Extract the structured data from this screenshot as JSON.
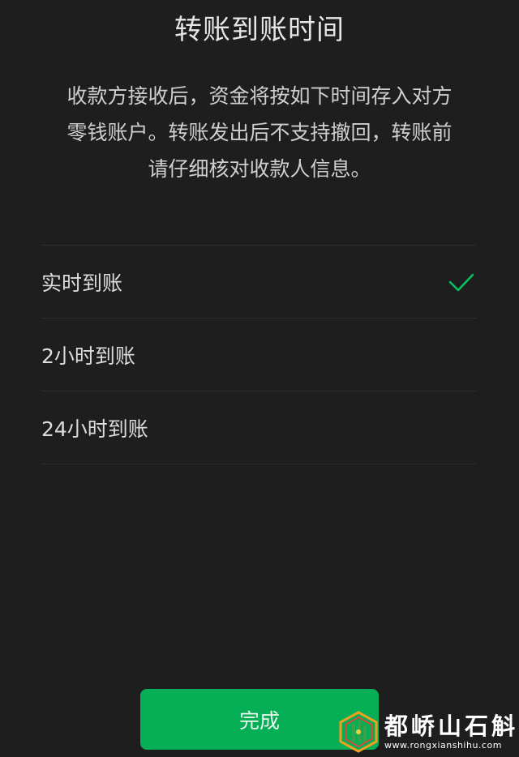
{
  "title": "转账到账时间",
  "description": {
    "line1": "收款方接收后，资金将按如下时间存入对方",
    "line2": "零钱账户。转账发出后不支持撤回，转账前",
    "line3": "请仔细核对收款人信息。"
  },
  "options": [
    {
      "label": "实时到账",
      "selected": true
    },
    {
      "label": "2小时到账",
      "selected": false
    },
    {
      "label": "24小时到账",
      "selected": false
    }
  ],
  "done_button": {
    "label": "完成"
  },
  "watermark": {
    "text": "都峤山石斛",
    "url": "www.rongxianshihu.com"
  },
  "colors": {
    "background": "#1e1e1e",
    "accent": "#06ae56",
    "check": "#07c160"
  },
  "icons": {
    "selected": "checkmark-icon",
    "logo": "watermark-logo-icon"
  }
}
